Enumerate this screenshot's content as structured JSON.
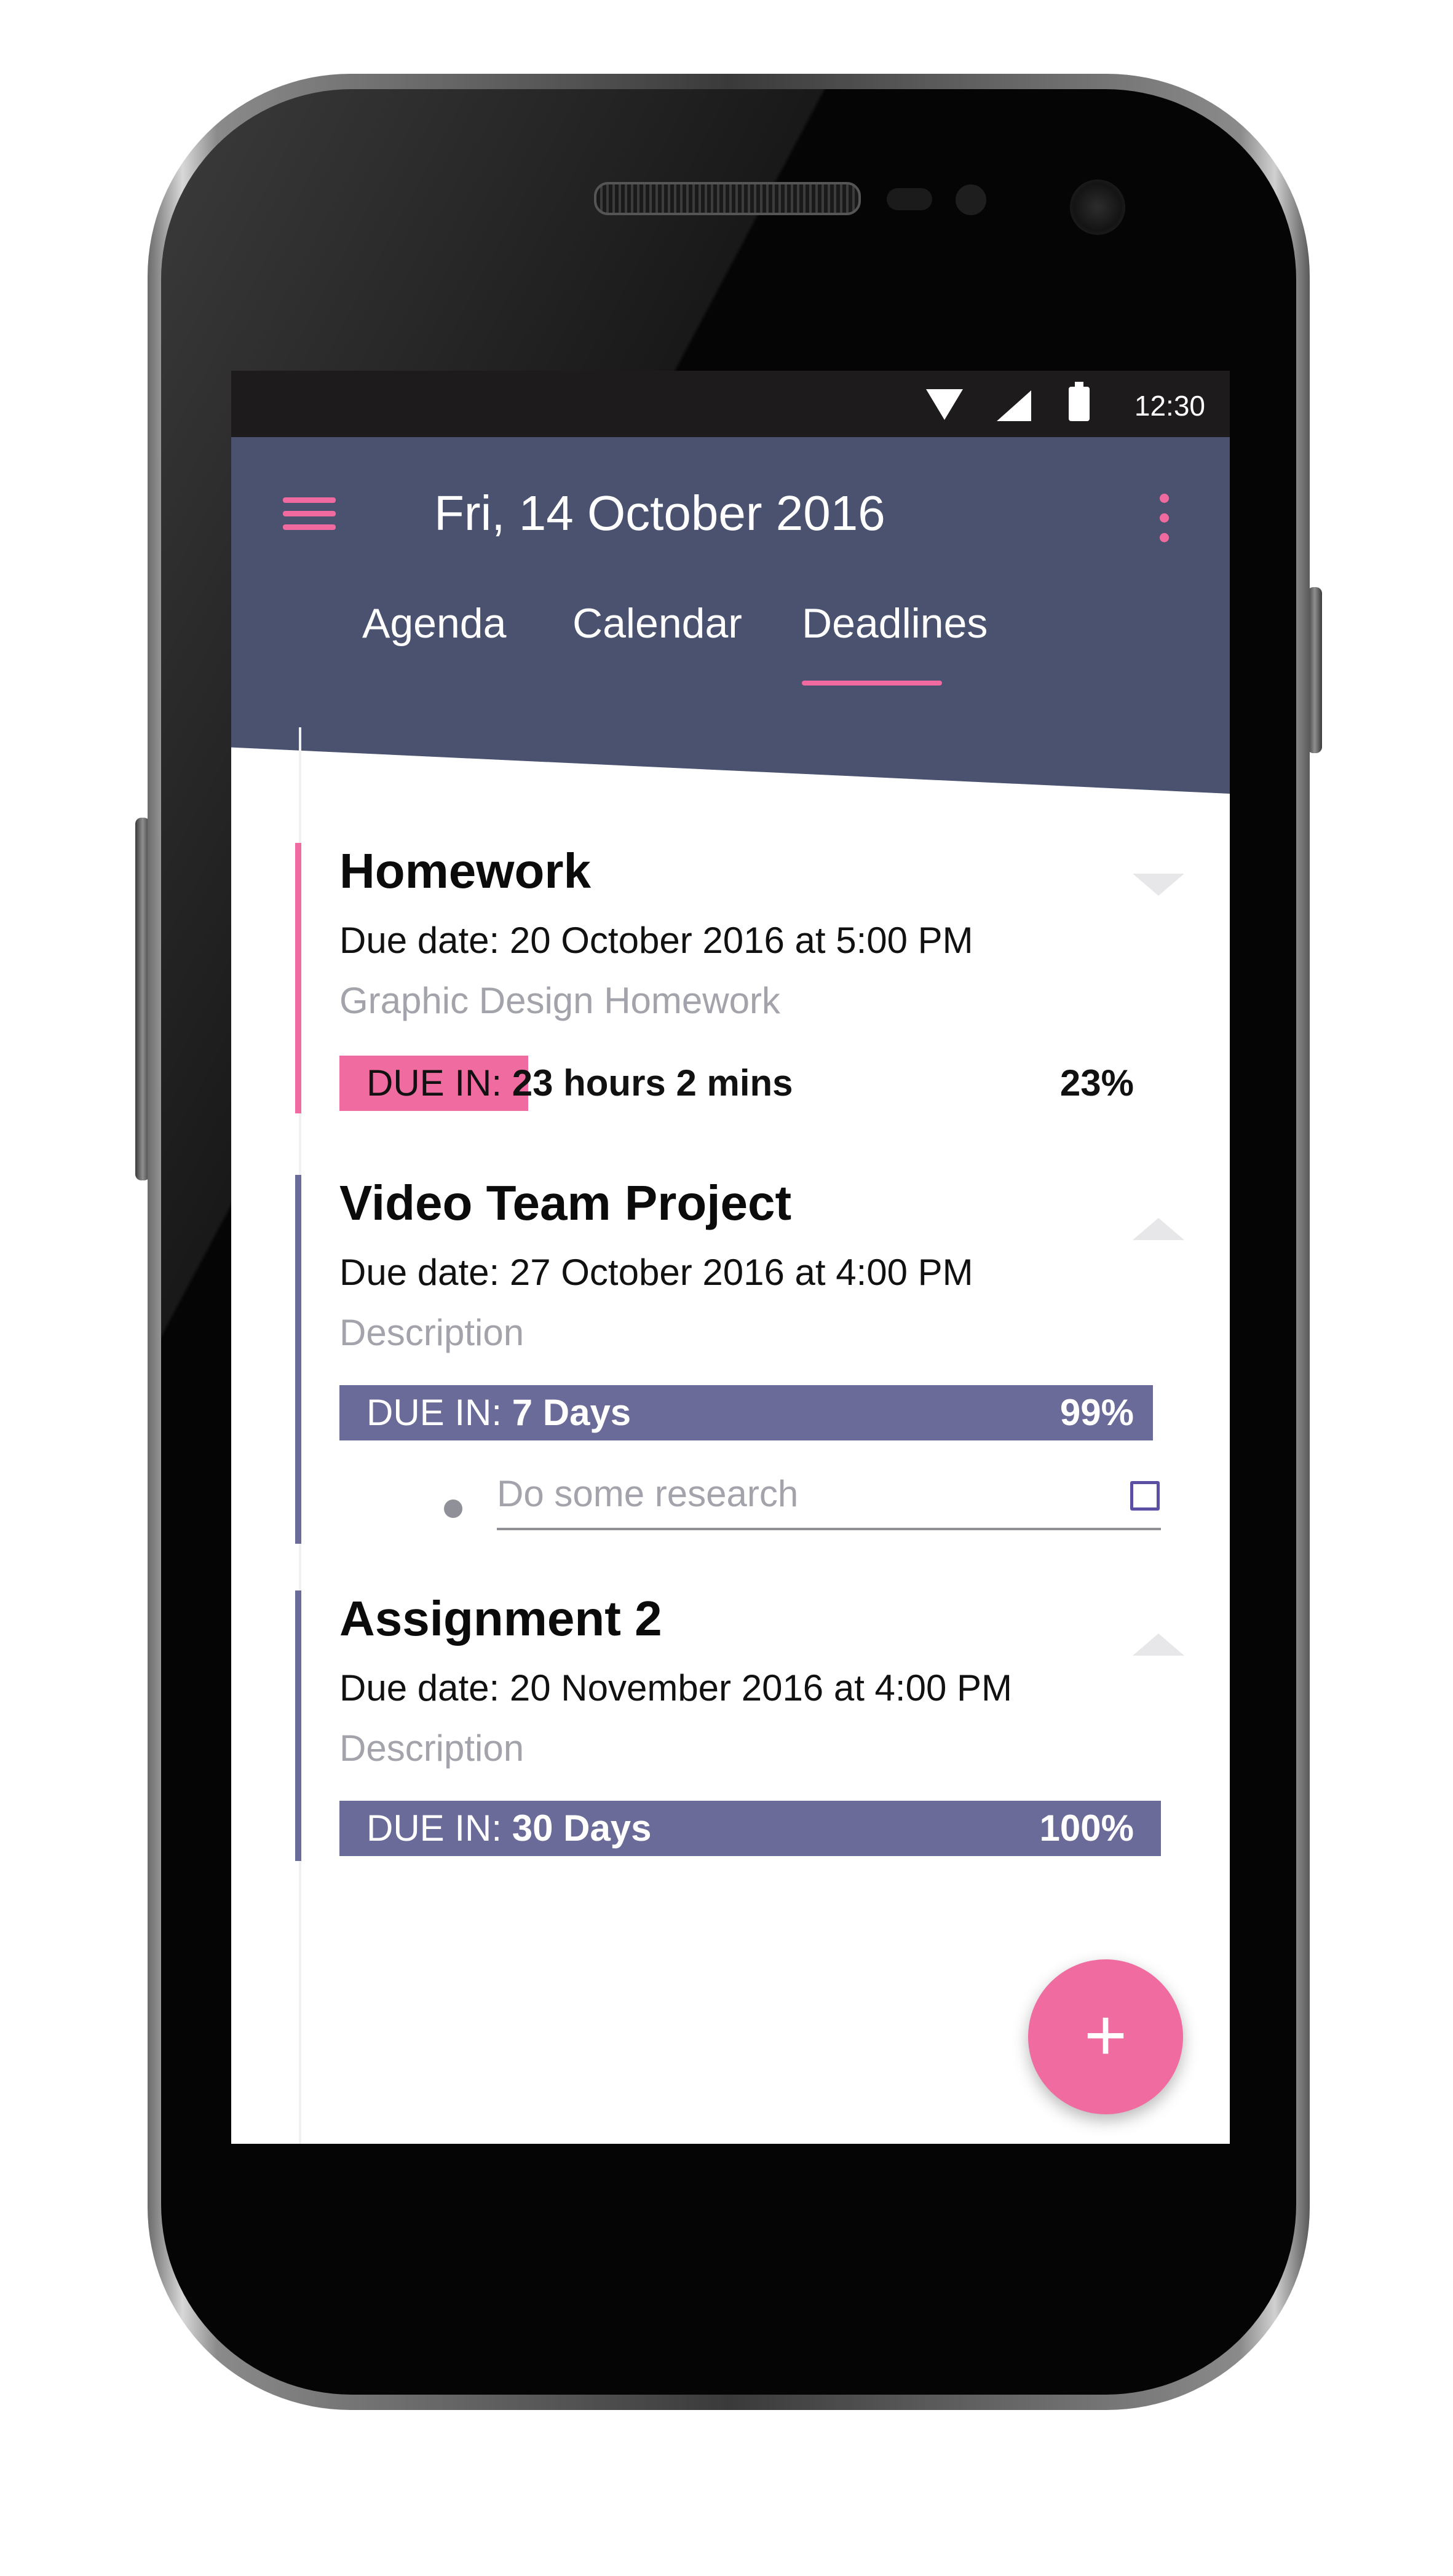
{
  "status_bar": {
    "time": "12:30"
  },
  "header": {
    "title": "Fri, 14 October 2016",
    "tabs": [
      {
        "label": "Agenda"
      },
      {
        "label": "Calendar"
      },
      {
        "label": "Deadlines"
      }
    ],
    "active_tab": "Deadlines"
  },
  "deadlines": [
    {
      "title": "Homework",
      "due": "Due date: 20 October 2016 at 5:00 PM",
      "description": "Graphic Design Homework",
      "due_in_prefix": "DUE IN:",
      "due_in_value": "23 hours 2 mins",
      "percent": "23%",
      "progress": 0.23,
      "expanded": false
    },
    {
      "title": "Video Team Project",
      "due": "Due date: 27 October 2016 at 4:00 PM",
      "description": "Description",
      "due_in_prefix": "DUE IN:",
      "due_in_value": "7 Days",
      "percent": "99%",
      "progress": 0.99,
      "expanded": true,
      "subtasks": [
        {
          "text": "Do some research",
          "checked": false
        }
      ]
    },
    {
      "title": "Assignment 2",
      "due": "Due date: 20 November 2016 at 4:00 PM",
      "description": "Description",
      "due_in_prefix": "DUE IN:",
      "due_in_value": "30 Days",
      "percent": "100%",
      "progress": 1.0,
      "expanded": true
    }
  ],
  "fab": {
    "icon": "plus-icon",
    "symbol": "+"
  },
  "colors": {
    "accent_pink": "#ef6ba0",
    "header_bg": "#4a5270",
    "progress_purple": "#6a6b98",
    "status_bar_bg": "#1e1b1c"
  }
}
